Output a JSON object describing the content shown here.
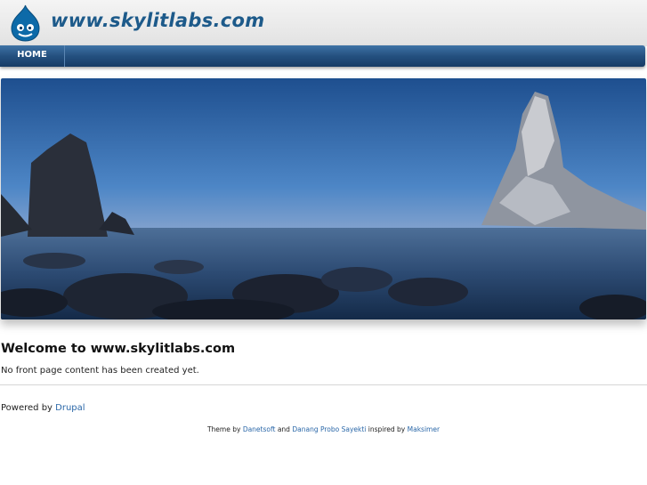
{
  "header": {
    "site_name": "www.skylitlabs.com",
    "logo_icon": "drupal-drop-icon"
  },
  "nav": {
    "items": [
      {
        "label": "HOME"
      }
    ]
  },
  "hero": {
    "icon": "seascape-banner-image"
  },
  "main": {
    "title": "Welcome to www.skylitlabs.com",
    "body": "No front page content has been created yet."
  },
  "footer": {
    "powered_prefix": "Powered by",
    "powered_link": "Drupal",
    "theme_prefix": "Theme by",
    "theme_author1": "Danetsoft",
    "theme_and": "and",
    "theme_author2": "Danang Probo Sayekti",
    "theme_inspired": "inspired by",
    "theme_author3": "Maksimer"
  },
  "colors": {
    "brand": "#1d5a8a",
    "nav_top": "#3f73a6",
    "nav_bottom": "#173c66",
    "link": "#2a67a8"
  }
}
